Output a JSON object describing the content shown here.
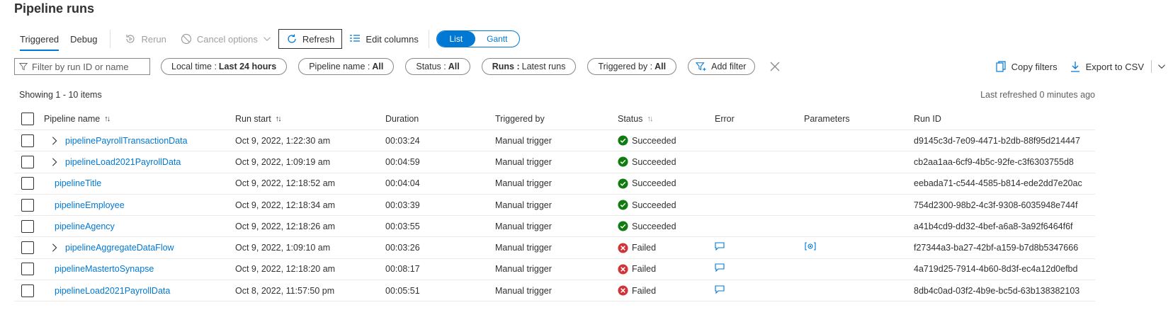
{
  "page": {
    "title": "Pipeline runs"
  },
  "toolbar": {
    "tabs": [
      "Triggered",
      "Debug"
    ],
    "rerun": "Rerun",
    "cancel": "Cancel options",
    "refresh": "Refresh",
    "edit_columns": "Edit columns",
    "view_list": "List",
    "view_gantt": "Gantt"
  },
  "filters": {
    "search_placeholder": "Filter by run ID or name",
    "local_time_label": "Local time :",
    "local_time_value": "Last 24 hours",
    "pipeline_name_label": "Pipeline name :",
    "pipeline_name_value": "All",
    "status_label": "Status :",
    "status_value": "All",
    "runs_label": "Runs :",
    "runs_value": "Latest runs",
    "triggered_by_label": "Triggered by :",
    "triggered_by_value": "All",
    "add_filter": "Add filter",
    "copy_filters": "Copy filters",
    "export_csv": "Export to CSV"
  },
  "summary": {
    "showing": "Showing 1 - 10 items",
    "last_refreshed": "Last refreshed 0 minutes ago"
  },
  "columns": {
    "pipeline_name": "Pipeline name",
    "run_start": "Run start",
    "duration": "Duration",
    "triggered_by": "Triggered by",
    "status": "Status",
    "error": "Error",
    "parameters": "Parameters",
    "run_id": "Run ID"
  },
  "colors": {
    "accent": "#0078d4",
    "success": "#107c10",
    "failed": "#d13438"
  },
  "rows": [
    {
      "name": "pipelinePayrollTransactionData",
      "expandable": true,
      "start": "Oct 9, 2022, 1:22:30 am",
      "duration": "00:03:24",
      "trigger": "Manual trigger",
      "status": "Succeeded",
      "has_error": false,
      "has_params": false,
      "run_id": "d9145c3d-7e09-4471-b2db-88f95d214447"
    },
    {
      "name": "pipelineLoad2021PayrollData",
      "expandable": true,
      "start": "Oct 9, 2022, 1:09:19 am",
      "duration": "00:04:59",
      "trigger": "Manual trigger",
      "status": "Succeeded",
      "has_error": false,
      "has_params": false,
      "run_id": "cb2aa1aa-6cf9-4b5c-92fe-c3f6303755d8"
    },
    {
      "name": "pipelineTitle",
      "expandable": false,
      "start": "Oct 9, 2022, 12:18:52 am",
      "duration": "00:04:04",
      "trigger": "Manual trigger",
      "status": "Succeeded",
      "has_error": false,
      "has_params": false,
      "run_id": "eebada71-c544-4585-b814-ede2dd7e20ac"
    },
    {
      "name": "pipelineEmployee",
      "expandable": false,
      "start": "Oct 9, 2022, 12:18:34 am",
      "duration": "00:03:39",
      "trigger": "Manual trigger",
      "status": "Succeeded",
      "has_error": false,
      "has_params": false,
      "run_id": "754d2300-98b2-4c3f-9308-6035948e744f"
    },
    {
      "name": "pipelineAgency",
      "expandable": false,
      "start": "Oct 9, 2022, 12:18:26 am",
      "duration": "00:03:55",
      "trigger": "Manual trigger",
      "status": "Succeeded",
      "has_error": false,
      "has_params": false,
      "run_id": "a41b4cd9-dd32-4bef-a6a8-3a92f6464f6f"
    },
    {
      "name": "pipelineAggregateDataFlow",
      "expandable": true,
      "start": "Oct 9, 2022, 1:09:10 am",
      "duration": "00:03:26",
      "trigger": "Manual trigger",
      "status": "Failed",
      "has_error": true,
      "has_params": true,
      "run_id": "f27344a3-ba27-42bf-a159-b7d8b5347666"
    },
    {
      "name": "pipelineMastertoSynapse",
      "expandable": false,
      "start": "Oct 9, 2022, 12:18:20 am",
      "duration": "00:08:17",
      "trigger": "Manual trigger",
      "status": "Failed",
      "has_error": true,
      "has_params": false,
      "run_id": "4a719d25-7914-4b60-8d3f-ec4a12d0efbd"
    },
    {
      "name": "pipelineLoad2021PayrollData",
      "expandable": false,
      "start": "Oct 8, 2022, 11:57:50 pm",
      "duration": "00:05:51",
      "trigger": "Manual trigger",
      "status": "Failed",
      "has_error": true,
      "has_params": false,
      "run_id": "8db4c0ad-03f2-4b9e-bc5d-63b138382103"
    }
  ]
}
